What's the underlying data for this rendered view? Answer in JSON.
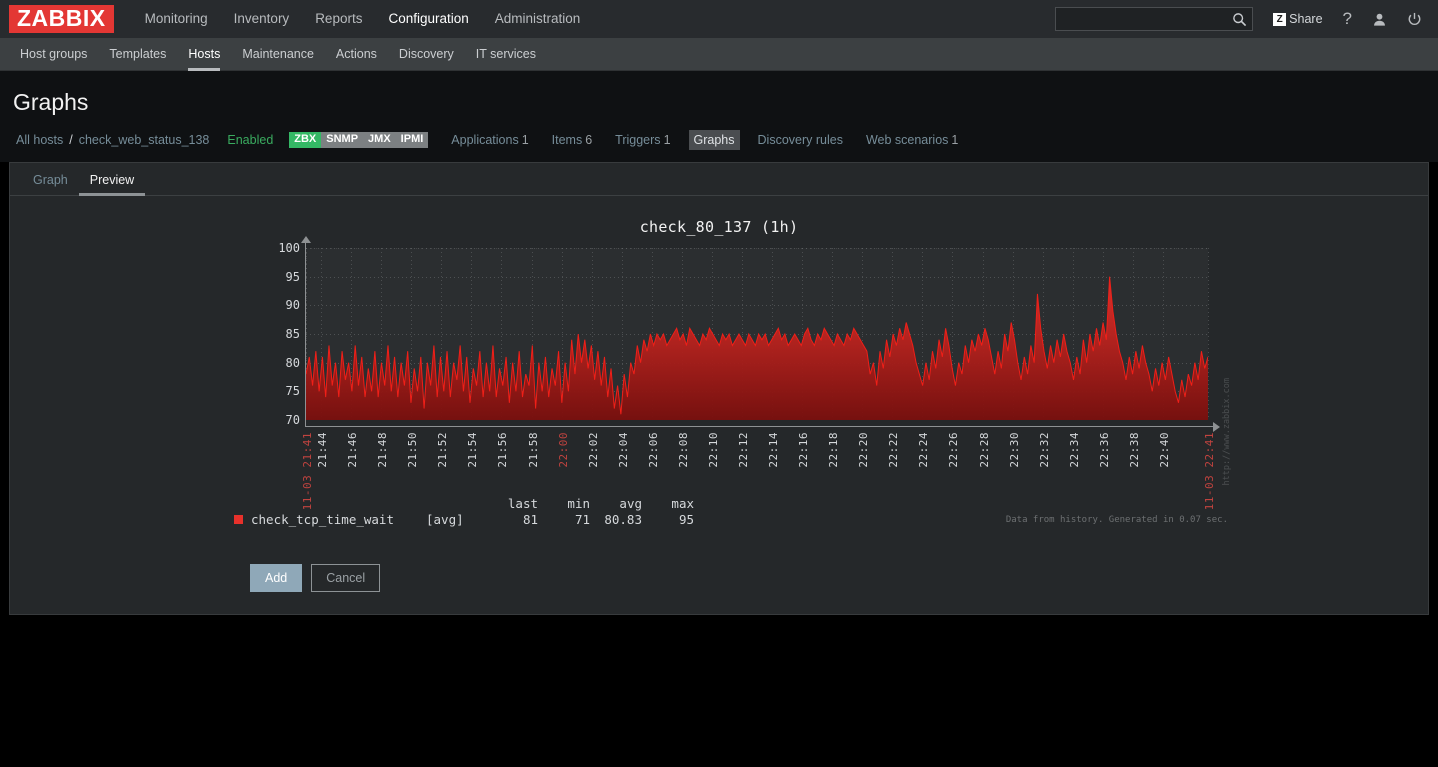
{
  "topnav": {
    "logo": "ZABBIX",
    "items": [
      {
        "label": "Monitoring",
        "selected": false
      },
      {
        "label": "Inventory",
        "selected": false
      },
      {
        "label": "Reports",
        "selected": false
      },
      {
        "label": "Configuration",
        "selected": true
      },
      {
        "label": "Administration",
        "selected": false
      }
    ],
    "search_value": "",
    "search_placeholder": "",
    "share_label": "Share",
    "share_badge": "Z",
    "help_label": "?"
  },
  "subnav": {
    "items": [
      {
        "label": "Host groups",
        "selected": false
      },
      {
        "label": "Templates",
        "selected": false
      },
      {
        "label": "Hosts",
        "selected": true
      },
      {
        "label": "Maintenance",
        "selected": false
      },
      {
        "label": "Actions",
        "selected": false
      },
      {
        "label": "Discovery",
        "selected": false
      },
      {
        "label": "IT services",
        "selected": false
      }
    ]
  },
  "page": {
    "title": "Graphs"
  },
  "hostbar": {
    "all_hosts": "All hosts",
    "separator": "/",
    "host_name": "check_web_status_138",
    "status": "Enabled",
    "interfaces": [
      {
        "label": "ZBX",
        "active": true
      },
      {
        "label": "SNMP",
        "active": false
      },
      {
        "label": "JMX",
        "active": false
      },
      {
        "label": "IPMI",
        "active": false
      }
    ],
    "tabs": [
      {
        "label": "Applications",
        "count": "1",
        "selected": false
      },
      {
        "label": "Items",
        "count": "6",
        "selected": false
      },
      {
        "label": "Triggers",
        "count": "1",
        "selected": false
      },
      {
        "label": "Graphs",
        "count": "",
        "selected": true
      },
      {
        "label": "Discovery rules",
        "count": "",
        "selected": false
      },
      {
        "label": "Web scenarios",
        "count": "1",
        "selected": false
      }
    ]
  },
  "panel": {
    "tabs": [
      {
        "label": "Graph",
        "active": false
      },
      {
        "label": "Preview",
        "active": true
      }
    ],
    "buttons": {
      "add": "Add",
      "cancel": "Cancel"
    },
    "footer_note": "Data from history. Generated in 0.07 sec.",
    "watermark": "http://www.zabbix.com"
  },
  "legend": {
    "headers": {
      "last": "last",
      "min": "min",
      "avg": "avg",
      "max": "max"
    },
    "series_name": "check_tcp_time_wait",
    "aggregate": "[avg]",
    "last": "81",
    "min": "71",
    "avg": "80.83",
    "max": "95",
    "color": "#e8312b"
  },
  "chart_data": {
    "type": "area",
    "title": "check_80_137 (1h)",
    "xlabel": "",
    "ylabel": "",
    "ylim": [
      70,
      100
    ],
    "yticks": [
      100,
      95,
      90,
      85,
      80,
      75,
      70
    ],
    "grid": true,
    "legend_position": "bottom-left",
    "line_color": "#e8312b",
    "fill_color": "#8c1210",
    "xticks": [
      "11-03 21:41",
      "21:44",
      "21:46",
      "21:48",
      "21:50",
      "21:52",
      "21:54",
      "21:56",
      "21:58",
      "22:00",
      "22:02",
      "22:04",
      "22:06",
      "22:08",
      "22:10",
      "22:12",
      "22:14",
      "22:16",
      "22:18",
      "22:20",
      "22:22",
      "22:24",
      "22:26",
      "22:28",
      "22:30",
      "22:32",
      "22:34",
      "22:36",
      "22:38",
      "22:40",
      "11-03 22:41"
    ],
    "xtick_edge_indices": [
      0,
      9,
      30
    ],
    "series": [
      {
        "name": "check_tcp_time_wait",
        "aggregate": "avg",
        "stats": {
          "last": 81,
          "min": 71,
          "avg": 80.83,
          "max": 95
        },
        "values": [
          78,
          81,
          76,
          82,
          75,
          81,
          74,
          83,
          76,
          80,
          74,
          82,
          77,
          80,
          75,
          83,
          76,
          81,
          74,
          79,
          75,
          82,
          74,
          80,
          76,
          83,
          75,
          81,
          74,
          80,
          76,
          82,
          73,
          79,
          75,
          81,
          72,
          80,
          76,
          83,
          74,
          81,
          75,
          82,
          74,
          80,
          77,
          83,
          75,
          81,
          73,
          79,
          76,
          82,
          74,
          80,
          75,
          83,
          74,
          79,
          76,
          81,
          73,
          80,
          75,
          82,
          74,
          78,
          76,
          83,
          72,
          80,
          75,
          81,
          74,
          79,
          76,
          82,
          73,
          80,
          75,
          84,
          78,
          85,
          80,
          84,
          79,
          83,
          77,
          82,
          76,
          81,
          74,
          79,
          72,
          76,
          71,
          78,
          74,
          80,
          78,
          83,
          80,
          84,
          82,
          85,
          83,
          85,
          84,
          85,
          83,
          84,
          85,
          86,
          84,
          85,
          83,
          86,
          85,
          84,
          83,
          85,
          84,
          86,
          85,
          84,
          83,
          85,
          84,
          85,
          83,
          84,
          85,
          84,
          83,
          85,
          84,
          83,
          85,
          84,
          85,
          83,
          84,
          85,
          86,
          84,
          85,
          83,
          84,
          85,
          84,
          83,
          85,
          86,
          84,
          83,
          85,
          84,
          86,
          85,
          84,
          83,
          85,
          84,
          83,
          85,
          84,
          86,
          85,
          84,
          83,
          82,
          78,
          80,
          76,
          82,
          79,
          84,
          81,
          85,
          83,
          86,
          84,
          87,
          85,
          83,
          80,
          78,
          76,
          80,
          77,
          82,
          79,
          84,
          81,
          86,
          83,
          79,
          76,
          80,
          78,
          83,
          80,
          84,
          82,
          85,
          83,
          86,
          84,
          81,
          78,
          82,
          79,
          85,
          82,
          87,
          84,
          80,
          77,
          81,
          78,
          83,
          80,
          92,
          86,
          82,
          79,
          83,
          80,
          84,
          81,
          85,
          82,
          80,
          77,
          81,
          78,
          84,
          80,
          85,
          82,
          86,
          83,
          87,
          84,
          95,
          89,
          85,
          82,
          80,
          77,
          81,
          78,
          82,
          79,
          83,
          80,
          78,
          75,
          79,
          76,
          80,
          77,
          81,
          78,
          75,
          73,
          77,
          74,
          78,
          76,
          80,
          77,
          82,
          79,
          81
        ]
      }
    ]
  }
}
